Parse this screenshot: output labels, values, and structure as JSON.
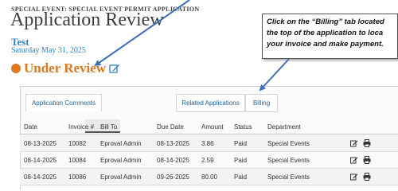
{
  "header": {
    "breadcrumb": "SPECIAL EVENT: SPECIAL EVENT PERMIT APPLICATION",
    "title": "Application Review",
    "record_name": "Test",
    "record_date": "Saturday May 31, 2025",
    "status": "Under Review"
  },
  "callout": {
    "lines": [
      "Click on the “Billing” tab located",
      "the top of the application to loca",
      "your invoice and make payment."
    ]
  },
  "tabs": {
    "comments": "Application Comments",
    "related": "Related Applications",
    "billing": "Billing"
  },
  "table": {
    "columns": [
      "Date",
      "Invoice #",
      "Bill To",
      "Due Date",
      "Amount",
      "Status",
      "Department"
    ],
    "rows": [
      [
        "08-13-2025",
        "10082",
        "Eproval Admin",
        "08-13-2025",
        "3.86",
        "Paid",
        "Special Events"
      ],
      [
        "08-14-2025",
        "10084",
        "Eproval Admin",
        "08-14-2025",
        "2.59",
        "Paid",
        "Special Events"
      ],
      [
        "08-14-2025",
        "10086",
        "Eproval Admin",
        "09-26-2025",
        "80.00",
        "Paid",
        "Special Events"
      ]
    ]
  },
  "colors": {
    "status_orange": "#d77a1f",
    "link_blue": "#2b86c4",
    "arrow_blue": "#3f6fb5"
  }
}
